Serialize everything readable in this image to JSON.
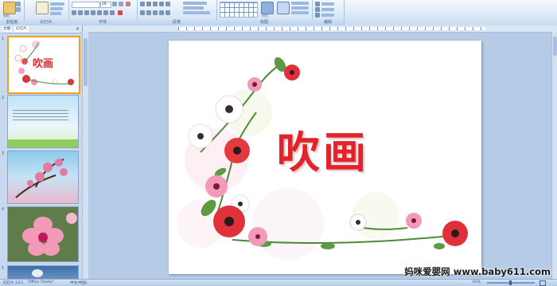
{
  "ribbon": {
    "groups": [
      {
        "label": "剪贴板"
      },
      {
        "label": "幻灯片"
      },
      {
        "label": "字体"
      },
      {
        "label": "段落"
      },
      {
        "label": "绘图"
      },
      {
        "label": "编辑"
      }
    ],
    "paste_label": "粘贴",
    "new_slide_label": "新建\n幻灯片",
    "font_size": "28",
    "arrange_label": "排列",
    "quick_styles_label": "快速样式"
  },
  "panel": {
    "tab_outline": "大纲",
    "tab_slides": "幻灯片",
    "slide_numbers": [
      "1",
      "2",
      "3",
      "4",
      "5"
    ],
    "thumb1_title": "吹画"
  },
  "slide": {
    "title": "吹画"
  },
  "status": {
    "slide_info": "幻灯片 1/13",
    "theme": "\"Office Theme\"",
    "language": "中文(中国)",
    "zoom": "61%"
  },
  "watermark": "妈咪爱婴网 www.baby611.com",
  "colors": {
    "title_red": "#e0232c",
    "ribbon_blue": "#cbdcf1"
  }
}
